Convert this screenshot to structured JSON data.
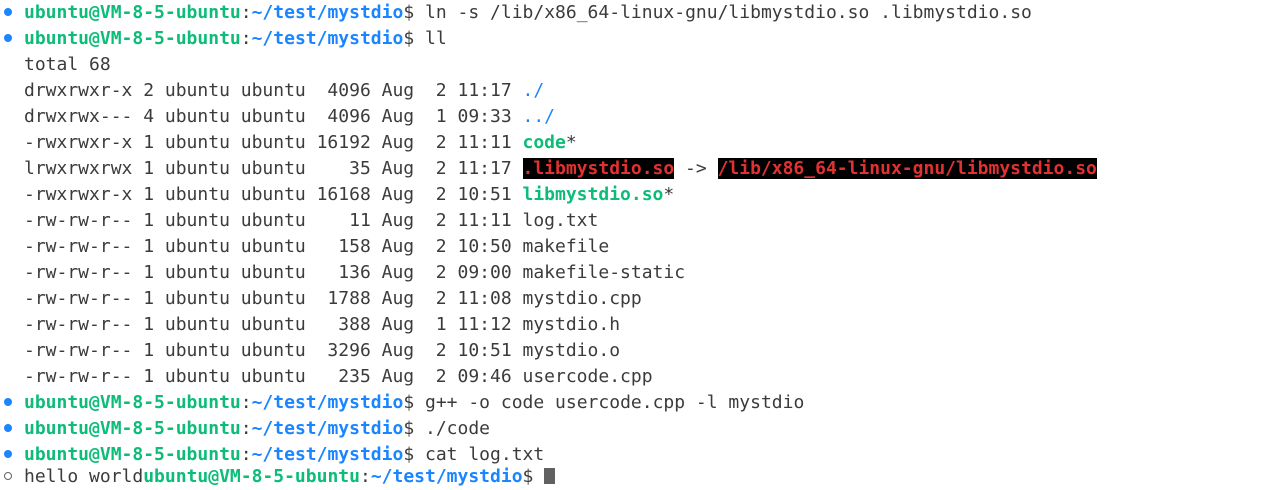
{
  "prompt": {
    "user_host": "ubuntu@VM-8-5-ubuntu",
    "colon": ":",
    "path": "~/test/mystdio",
    "dollar": "$ "
  },
  "commands": {
    "ln": "ln -s /lib/x86_64-linux-gnu/libmystdio.so .libmystdio.so",
    "ll": "ll",
    "gpp": "g++ -o code usercode.cpp -l mystdio",
    "run": "./code",
    "cat": "cat log.txt"
  },
  "listing": {
    "total": "total 68",
    "rows": [
      {
        "meta": "drwxrwxr-x 2 ubuntu ubuntu  4096 Aug  2 11:17 ",
        "name": "./",
        "kind": "dir",
        "suffix": ""
      },
      {
        "meta": "drwxrwx--- 4 ubuntu ubuntu  4096 Aug  1 09:33 ",
        "name": "../",
        "kind": "dir",
        "suffix": ""
      },
      {
        "meta": "-rwxrwxr-x 1 ubuntu ubuntu 16192 Aug  2 11:11 ",
        "name": "code",
        "kind": "exec",
        "suffix": "*"
      },
      {
        "meta": "lrwxrwxrwx 1 ubuntu ubuntu    35 Aug  2 11:17 ",
        "name": ".libmystdio.so",
        "kind": "broken",
        "arrow": " -> ",
        "target": "/lib/x86_64-linux-gnu/libmystdio.so",
        "suffix": ""
      },
      {
        "meta": "-rwxrwxr-x 1 ubuntu ubuntu 16168 Aug  2 10:51 ",
        "name": "libmystdio.so",
        "kind": "exec",
        "suffix": "*"
      },
      {
        "meta": "-rw-rw-r-- 1 ubuntu ubuntu    11 Aug  2 11:11 ",
        "name": "log.txt",
        "kind": "plain",
        "suffix": ""
      },
      {
        "meta": "-rw-rw-r-- 1 ubuntu ubuntu   158 Aug  2 10:50 ",
        "name": "makefile",
        "kind": "plain",
        "suffix": ""
      },
      {
        "meta": "-rw-rw-r-- 1 ubuntu ubuntu   136 Aug  2 09:00 ",
        "name": "makefile-static",
        "kind": "plain",
        "suffix": ""
      },
      {
        "meta": "-rw-rw-r-- 1 ubuntu ubuntu  1788 Aug  2 11:08 ",
        "name": "mystdio.cpp",
        "kind": "plain",
        "suffix": ""
      },
      {
        "meta": "-rw-rw-r-- 1 ubuntu ubuntu   388 Aug  1 11:12 ",
        "name": "mystdio.h",
        "kind": "plain",
        "suffix": ""
      },
      {
        "meta": "-rw-rw-r-- 1 ubuntu ubuntu  3296 Aug  2 10:51 ",
        "name": "mystdio.o",
        "kind": "plain",
        "suffix": ""
      },
      {
        "meta": "-rw-rw-r-- 1 ubuntu ubuntu   235 Aug  2 09:46 ",
        "name": "usercode.cpp",
        "kind": "plain",
        "suffix": ""
      }
    ]
  },
  "output": {
    "cat_result": "hello world"
  },
  "colors": {
    "prompt_user": "#0dbc79",
    "prompt_path": "#1a85ff",
    "directory": "#1a85ff",
    "executable": "#0dbc79",
    "broken_link": "#e23131",
    "broken_link_bg": "#000000",
    "status_ok": "#1a85ff"
  }
}
